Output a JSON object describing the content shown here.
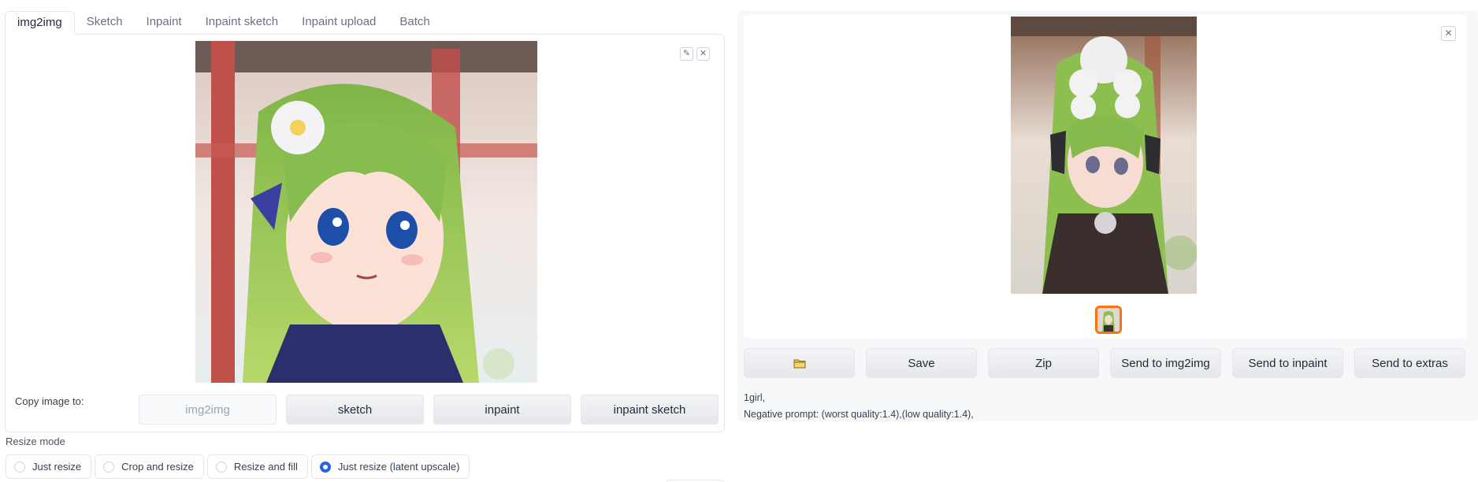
{
  "tabs": [
    {
      "label": "img2img",
      "active": true
    },
    {
      "label": "Sketch"
    },
    {
      "label": "Inpaint"
    },
    {
      "label": "Inpaint sketch"
    },
    {
      "label": "Inpaint upload"
    },
    {
      "label": "Batch"
    }
  ],
  "image_tools": {
    "edit_icon": "pencil-icon",
    "close_icon": "close-icon",
    "edit_glyph": "✎",
    "close_glyph": "✕"
  },
  "copy": {
    "label": "Copy image to:",
    "buttons": [
      "img2img",
      "sketch",
      "inpaint",
      "inpaint sketch"
    ]
  },
  "resize": {
    "label": "Resize mode",
    "options": [
      "Just resize",
      "Crop and resize",
      "Resize and fill",
      "Just resize (latent upscale)"
    ],
    "selected": "Just resize (latent upscale)"
  },
  "gallery": {
    "close_glyph": "✕"
  },
  "actions": {
    "folder_icon": "folder-icon",
    "save": "Save",
    "zip": "Zip",
    "send_img2img": "Send to img2img",
    "send_inpaint": "Send to inpaint",
    "send_extras": "Send to extras"
  },
  "generation_info": {
    "prompt": "1girl,",
    "negative": "Negative prompt: (worst quality:1.4),(low quality:1.4),"
  },
  "colors": {
    "accent": "#f97316",
    "radio": "#2563eb",
    "hair": "#8fc24a"
  }
}
